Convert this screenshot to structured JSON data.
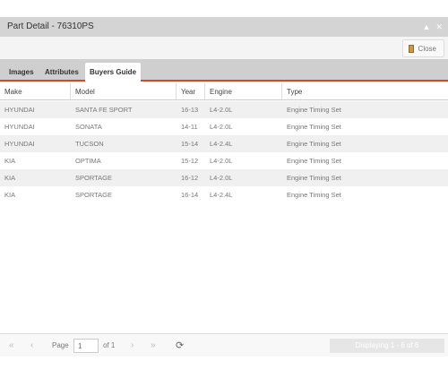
{
  "window": {
    "title": "Part Detail - 76310PS",
    "collapse_icon": "caret-up-icon",
    "close_icon": "close-x-icon"
  },
  "toolbar": {
    "close_label": "Close",
    "close_icon": "door-icon"
  },
  "tabs": [
    {
      "label": "Images"
    },
    {
      "label": "Attributes"
    },
    {
      "label": "Buyers Guide",
      "active": true
    }
  ],
  "grid": {
    "columns": [
      "Make",
      "Model",
      "Year",
      "Engine",
      "Type"
    ],
    "rows": [
      {
        "make": "HYUNDAI",
        "model": "SANTA FE SPORT",
        "year": "16-13",
        "engine": "L4-2.0L",
        "type": "Engine Timing Set"
      },
      {
        "make": "HYUNDAI",
        "model": "SONATA",
        "year": "14-11",
        "engine": "L4-2.0L",
        "type": "Engine Timing Set"
      },
      {
        "make": "HYUNDAI",
        "model": "TUCSON",
        "year": "15-14",
        "engine": "L4-2.4L",
        "type": "Engine Timing Set"
      },
      {
        "make": "KIA",
        "model": "OPTIMA",
        "year": "15-12",
        "engine": "L4-2.0L",
        "type": "Engine Timing Set"
      },
      {
        "make": "KIA",
        "model": "SPORTAGE",
        "year": "16-12",
        "engine": "L4-2.0L",
        "type": "Engine Timing Set"
      },
      {
        "make": "KIA",
        "model": "SPORTAGE",
        "year": "16-14",
        "engine": "L4-2.4L",
        "type": "Engine Timing Set"
      }
    ]
  },
  "pager": {
    "page_label": "Page",
    "page_value": "1",
    "of_label": "of 1",
    "displaying": "Displaying 1 - 6 of 6"
  },
  "colors": {
    "accent": "#d24926",
    "titlebar": "#d4d4d4",
    "tabbar": "#cfcfcf"
  }
}
